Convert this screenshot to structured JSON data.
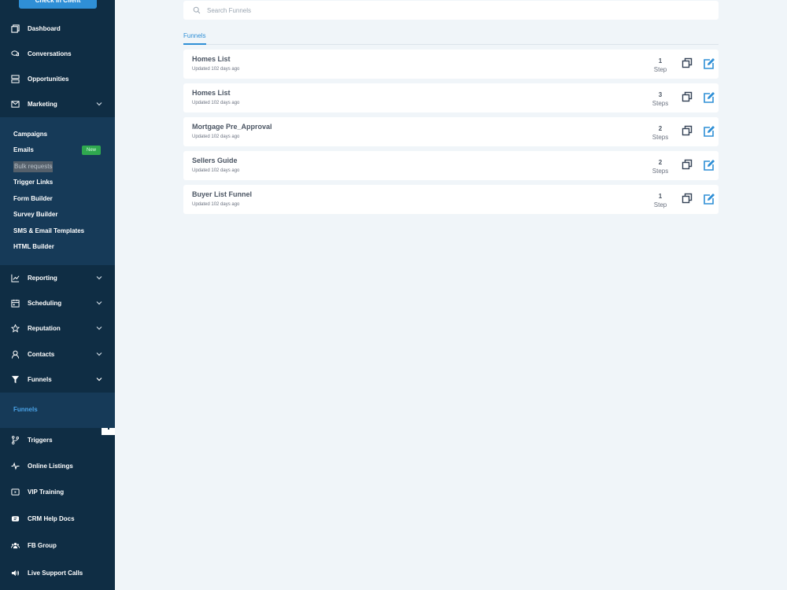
{
  "sidebar": {
    "top_button": "Check in Client",
    "nav": [
      {
        "label": "Dashboard",
        "icon": "dashboard-icon"
      },
      {
        "label": "Conversations",
        "icon": "chat-icon"
      },
      {
        "label": "Opportunities",
        "icon": "opportunities-icon"
      },
      {
        "label": "Marketing",
        "icon": "mail-icon"
      }
    ],
    "marketing_sub": [
      "Campaigns",
      "Emails",
      "Bulk requests",
      "Trigger Links",
      "Form Builder",
      "Survey Builder",
      "SMS & Email Templates",
      "HTML Builder"
    ],
    "new_badge": "New",
    "nav2": [
      {
        "label": "Reporting",
        "icon": "chart-icon"
      },
      {
        "label": "Scheduling",
        "icon": "calendar-icon"
      },
      {
        "label": "Reputation",
        "icon": "star-icon"
      },
      {
        "label": "Contacts",
        "icon": "person-icon"
      },
      {
        "label": "Funnels",
        "icon": "filter-icon"
      }
    ],
    "funnels_sub": "Funnels",
    "nav3": [
      {
        "label": "Triggers",
        "icon": "branch-icon"
      },
      {
        "label": "Online Listings",
        "icon": "pulse-icon"
      },
      {
        "label": "VIP Training",
        "icon": "video-icon"
      },
      {
        "label": "CRM Help Docs",
        "icon": "docs-icon"
      },
      {
        "label": "FB Group",
        "icon": "group-icon"
      },
      {
        "label": "Live Support Calls",
        "icon": "speaker-icon"
      }
    ]
  },
  "search": {
    "placeholder": "Search Funnels"
  },
  "tabs": [
    "Funnels"
  ],
  "funnels": [
    {
      "name": "Homes List",
      "updated": "Updated 102 days ago",
      "count": "1",
      "unit": "Step"
    },
    {
      "name": "Homes List",
      "updated": "Updated 102 days ago",
      "count": "3",
      "unit": "Steps"
    },
    {
      "name": "Mortgage Pre_Approval",
      "updated": "Updated 102 days ago",
      "count": "2",
      "unit": "Steps"
    },
    {
      "name": "Sellers Guide",
      "updated": "Updated 102 days ago",
      "count": "2",
      "unit": "Steps"
    },
    {
      "name": "Buyer List Funnel",
      "updated": "Updated 102 days ago",
      "count": "1",
      "unit": "Step"
    }
  ],
  "colors": {
    "sidebar": "#0f2d44",
    "submenu": "#163a58",
    "accent": "#2f8fd6",
    "badge": "#2fa84f"
  }
}
